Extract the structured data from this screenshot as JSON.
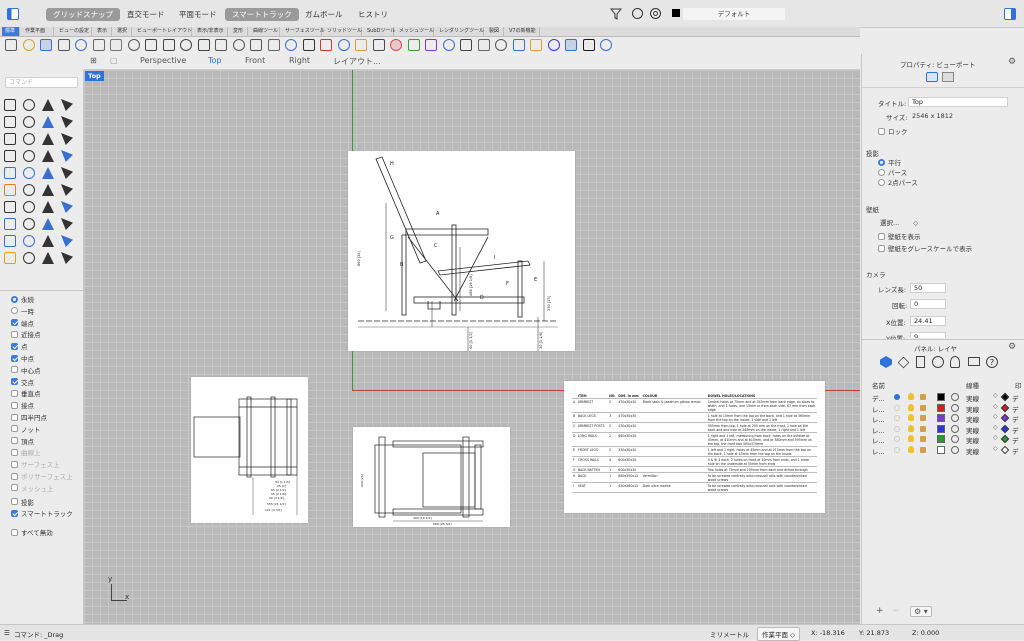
{
  "modes": [
    "グリッドスナップ",
    "直交モード",
    "平面モード",
    "スマートトラック",
    "ガムボール",
    "ヒストリ"
  ],
  "layer_default": "デフォルト",
  "toolbar_tabs": [
    "標準",
    "作業平面",
    "ビューの設定",
    "表示",
    "選択",
    "ビューポートレイアウト",
    "表示/非表示",
    "変形",
    "曲線ツール",
    "サーフェスツール",
    "ソリッドツール",
    "SubDツール",
    "メッシュツール",
    "レンダリングツール",
    "製図",
    "V7の新機能"
  ],
  "viewport_tabs": {
    "perspective": "Perspective",
    "top": "Top",
    "front": "Front",
    "right": "Right",
    "layout": "レイアウト..."
  },
  "command_placeholder": "コマンド",
  "viewport_label": "Top",
  "osnaps": [
    {
      "label": "永続",
      "type": "radio",
      "on": true
    },
    {
      "label": "一時",
      "type": "radio",
      "on": false
    },
    {
      "label": "端点",
      "on": true
    },
    {
      "label": "近接点",
      "on": false
    },
    {
      "label": "点",
      "on": true
    },
    {
      "label": "中点",
      "on": true
    },
    {
      "label": "中心点",
      "on": false
    },
    {
      "label": "交点",
      "on": true
    },
    {
      "label": "垂直点",
      "on": false
    },
    {
      "label": "接点",
      "on": false
    },
    {
      "label": "四半円点",
      "on": false
    },
    {
      "label": "ノット",
      "on": false
    },
    {
      "label": "頂点",
      "on": false
    },
    {
      "label": "曲線上",
      "on": false,
      "dim": true
    },
    {
      "label": "サーフェス上",
      "on": false,
      "dim": true
    },
    {
      "label": "ポリサーフェス上",
      "on": false,
      "dim": true
    },
    {
      "label": "メッシュ上",
      "on": false,
      "dim": true
    },
    {
      "label": "投影",
      "on": false
    },
    {
      "label": "スマートトラック",
      "on": true
    },
    {
      "label": "すべて無効",
      "on": false
    }
  ],
  "properties": {
    "header": "プロパティ: ビューポート",
    "title_label": "タイトル:",
    "title_value": "Top",
    "size_label": "サイズ:",
    "size_value": "2546 x 1812",
    "lock": "ロック",
    "projection_label": "投影",
    "parallel": "平行",
    "perspective": "パース",
    "two_point": "2点パース",
    "wallpaper_label": "壁紙",
    "select": "選択...",
    "show_wallpaper": "壁紙を表示",
    "grayscale": "壁紙をグレースケールで表示",
    "camera_label": "カメラ",
    "lens_label": "レンズ長:",
    "lens_value": "50",
    "rotation_label": "回転:",
    "rotation_value": "0",
    "xpos_label": "X位置:",
    "xpos_value": "24.41",
    "ypos_label": "Y位置:",
    "ypos_value": "9"
  },
  "layers": {
    "header": "パネル: レイヤ",
    "col_name": "名前",
    "col_linetype": "線種",
    "col_print": "印",
    "rows": [
      {
        "name": "デ...",
        "color": "#000000",
        "linetype": "実線",
        "print": "デ",
        "current": true
      },
      {
        "name": "レ...",
        "color": "#d02020",
        "linetype": "実線",
        "print": "デ"
      },
      {
        "name": "レ...",
        "color": "#7a3ad0",
        "linetype": "実線",
        "print": "デ"
      },
      {
        "name": "レ...",
        "color": "#2a3ad8",
        "linetype": "実線",
        "print": "デ"
      },
      {
        "name": "レ...",
        "color": "#2a9a2a",
        "linetype": "実線",
        "print": "デ"
      },
      {
        "name": "レ...",
        "color": "#ffffff",
        "linetype": "実線",
        "print": "デ"
      }
    ]
  },
  "drawing": {
    "labels": [
      "H",
      "A",
      "G",
      "C",
      "B",
      "I",
      "F",
      "E",
      "D"
    ],
    "dims": [
      "860 [34]",
      "488 [19 1/8]",
      "330 [13]",
      "40 [1 1/2]",
      "30 [1 1/8]"
    ],
    "plan_dims": [
      "34 [1 1/4]",
      "25 [1]",
      "65 [2 1/2]",
      "55 [2 1/8]",
      "90 [3 1/2]",
      "555 [21 1/2]",
      "121 [4 3/4]"
    ],
    "base_dims": [
      "660 [26]",
      "490 [19 1/4]",
      "680 [26 3/4]"
    ]
  },
  "parts_table": {
    "headers": [
      "",
      "ITEM",
      "NO.",
      "DIM. in mm",
      "COLOUR",
      "DOWEL HOLES/LOCATIONS"
    ],
    "rows": [
      [
        "A",
        "ARMREST",
        "2",
        "470x30x30",
        "Black stain & Jadehum yellow lemon",
        "Central holes at 75mm and at 345mm from back edge, on sides to width, and 1 holes, one 15mm in from each side, 67 mm from back edge"
      ],
      [
        "B",
        "BACK LEGS",
        "3",
        "470x30x30",
        "",
        "1 hole at 15mm from the top on the back, and 1 hole at 365mm from the top on the inside, 1 side and 1 left"
      ],
      [
        "C",
        "ARMREST POSTS",
        "2",
        "430x30x30",
        "",
        "305mm from top, 1 hole at 200 mm on the front, 1 hole on the back and one hole at 265mm on the inside, 1 right and 1 left"
      ],
      [
        "D",
        "LONG RAILS",
        "2",
        "660x30x30",
        "",
        "1 right and 1 left, measuring from back; holes on the outside at 45mm, at 410mm and at 615mm, and at 380mm and 595mm on the top, the front two 400x370mm"
      ],
      [
        "E",
        "FRONT LEGS",
        "2",
        "330x30x30",
        "",
        "1 left and 1 right, holes at 45mm and at 215mm from the top on the back, 1 hole at 45mm from the top on the inside"
      ],
      [
        "F",
        "CROSS RAILS",
        "4",
        "600x30x30",
        "",
        "4 & 9i 4 each, 2 holes on front at 30mm from ends, and 1 more hole on the underside at 55mm from ends"
      ],
      [
        "G",
        "BACK BATTEN",
        "1",
        "600x30x30",
        "",
        "Two holes at 75mm and 105mm from each end drilled through"
      ],
      [
        "H",
        "BACK",
        "1",
        "880x350x12",
        "Vermilion",
        "To be screwed centrally onto crossrail rails with countersinked wood screws"
      ],
      [
        "I",
        "SEAT",
        "1",
        "430x360x12",
        "Dark ultra marine",
        "To be screwed centrally onto crossrail rails with countersinked wood screws"
      ]
    ]
  },
  "axes": {
    "y": "y",
    "x": "x"
  },
  "status": {
    "command": "コマンド: _Drag",
    "units": "ミリメートル",
    "cplane": "作業平面",
    "x": "X: -18.316",
    "y": "Y: 21.873",
    "z": "Z: 0.000"
  }
}
